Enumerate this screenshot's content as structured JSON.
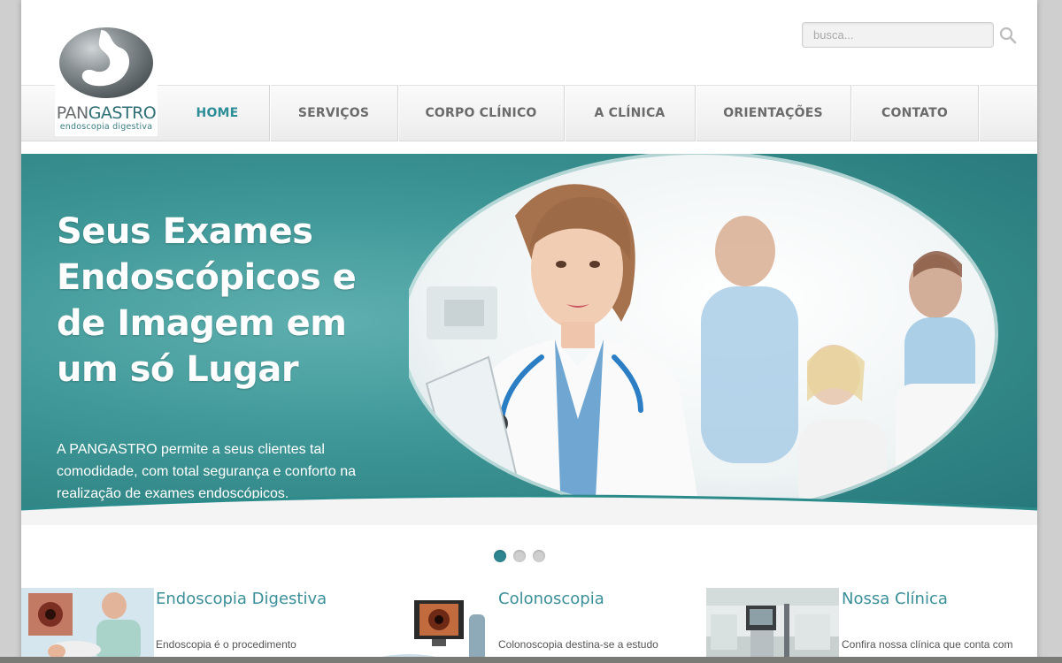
{
  "brand": {
    "name_part1": "PAN",
    "name_part2": "GASTRO",
    "tagline": "endoscopia digestiva"
  },
  "search": {
    "placeholder": "busca...",
    "icon": "search-icon"
  },
  "nav": {
    "items": [
      {
        "label": "HOME",
        "active": true
      },
      {
        "label": "SERVIÇOS",
        "active": false
      },
      {
        "label": "CORPO CLÍNICO",
        "active": false
      },
      {
        "label": "A CLÍNICA",
        "active": false
      },
      {
        "label": "ORIENTAÇÕES",
        "active": false
      },
      {
        "label": "CONTATO",
        "active": false
      }
    ]
  },
  "hero": {
    "title": "Seus Exames Endoscópicos e de Imagem em um só Lugar",
    "text": "A PANGASTRO permite a seus clientes tal comodidade, com total segurança e conforto na realização de exames endoscópicos."
  },
  "slider": {
    "total": 3,
    "active": 1
  },
  "features": [
    {
      "title": "Endoscopia Digestiva",
      "text": "Endoscopia é o procedimento"
    },
    {
      "title": "Colonoscopia",
      "text": "Colonoscopia destina-se a estudo"
    },
    {
      "title": "Nossa Clínica",
      "text": "Confira nossa clínica que conta com"
    }
  ],
  "colors": {
    "accent": "#2e8e98",
    "hero_bg": "#3f9797",
    "nav_text": "#6b6b6b"
  }
}
